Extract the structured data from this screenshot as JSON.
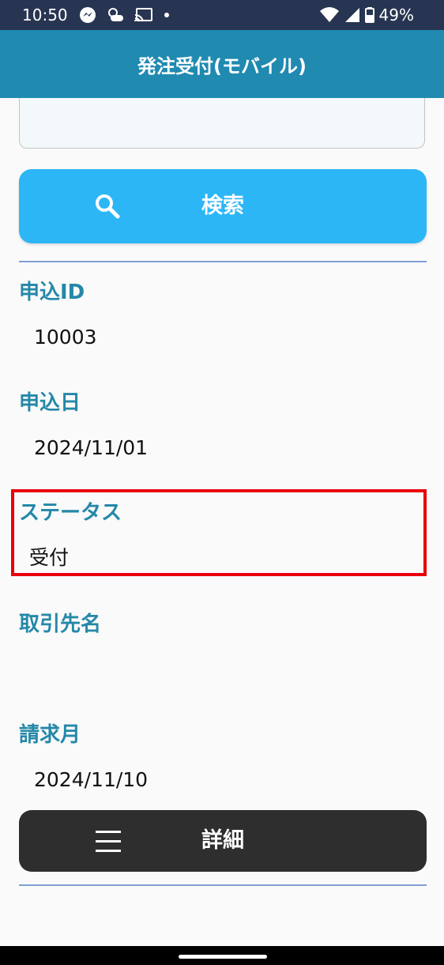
{
  "status_bar": {
    "time": "10:50",
    "battery_percent": "49%",
    "icons": [
      "messenger-icon",
      "weather-icon",
      "cast-icon",
      "dot-icon",
      "wifi-icon",
      "signal-icon",
      "battery-icon"
    ]
  },
  "header": {
    "title": "発注受付(モバイル)"
  },
  "search_button": {
    "label": "検索",
    "icon": "search-icon"
  },
  "fields": {
    "application_id": {
      "label": "申込ID",
      "value": "10003"
    },
    "application_date": {
      "label": "申込日",
      "value": "2024/11/01"
    },
    "status": {
      "label": "ステータス",
      "value": "受付"
    },
    "client_name": {
      "label": "取引先名",
      "value": ""
    },
    "billing_month": {
      "label": "請求月",
      "value": "2024/11/10"
    }
  },
  "detail_button": {
    "label": "詳細",
    "icon": "menu-icon"
  },
  "colors": {
    "status_bar": "#283552",
    "header": "#208ab1",
    "search_button": "#2cb6f6",
    "label_text": "#2488a8",
    "detail_button": "#2e2e2e",
    "highlight": "#e8000b",
    "divider": "#7f9fd4"
  }
}
